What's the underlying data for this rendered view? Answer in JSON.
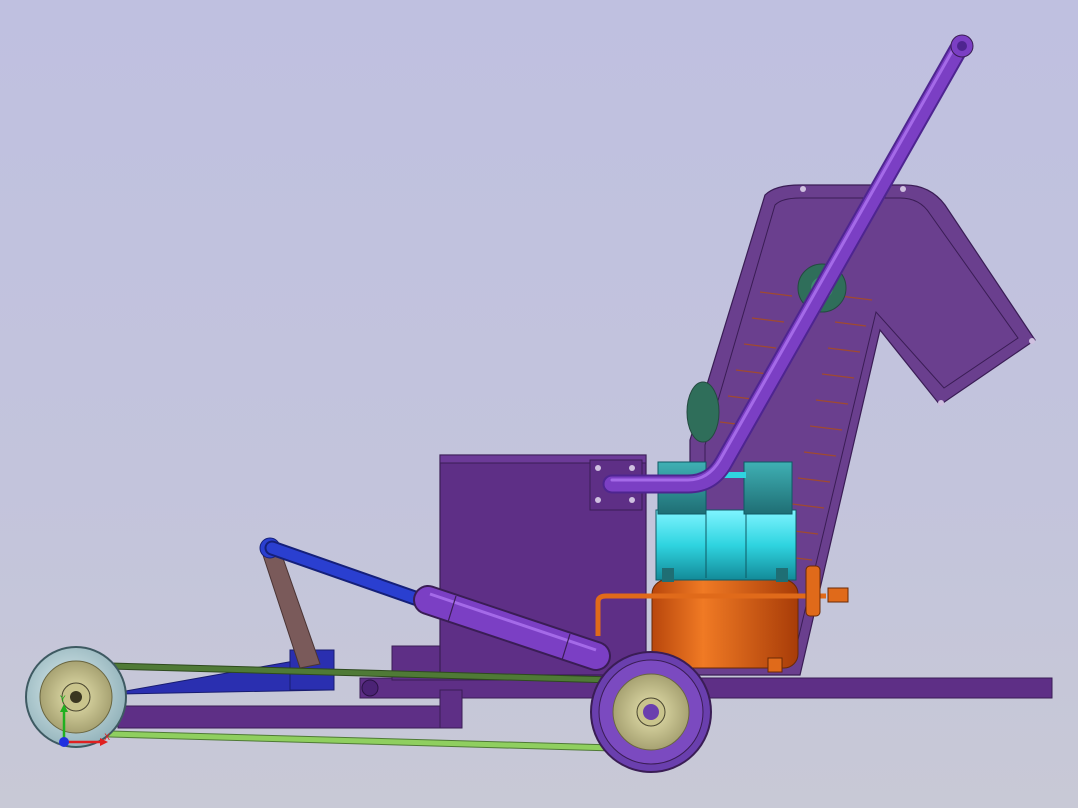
{
  "viewport": {
    "background_top": "#bfc0e0",
    "background_bottom": "#c8c9d6"
  },
  "model": {
    "parts": [
      "conveyor-housing",
      "discharge-pipe",
      "hopper-box",
      "air-compressor-heads",
      "air-tank",
      "hydraulic-cylinder",
      "linkage-arm",
      "front-pulley-wheel",
      "rear-pulley-wheel",
      "drive-belts",
      "base-frame"
    ],
    "colors": {
      "frame_purple": "#5e2f86",
      "housing_purple": "#6a3f8e",
      "pipe_violet": "#7b3fc4",
      "cyan": "#2fd4e0",
      "teal": "#2a8e94",
      "orange": "#e06a1a",
      "cylinder_blue": "#2a3fd0",
      "link_brown": "#7a5a5a",
      "wheel_yellow": "#c9c48c",
      "belt_green": "#4f7a36",
      "belt_light_green": "#8fcf5f"
    }
  },
  "triad": {
    "x_label": "X",
    "y_label": "Y",
    "x_color": "#e02020",
    "y_color": "#20b020",
    "z_color": "#2030e0"
  }
}
